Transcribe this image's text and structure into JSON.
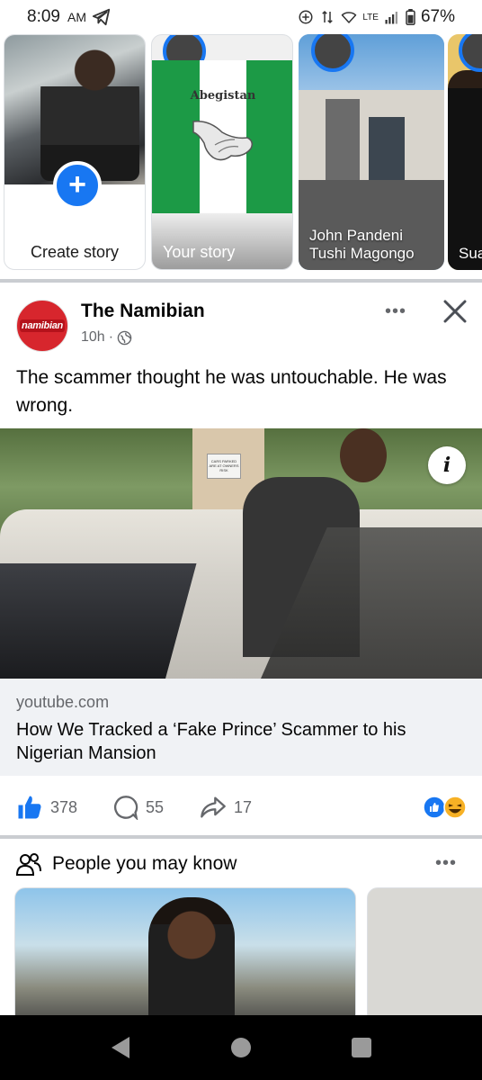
{
  "status_bar": {
    "time": "8:09",
    "ampm": "AM",
    "network": "LTE",
    "battery": "67%"
  },
  "stories": {
    "create_label": "Create story",
    "your_story_label": "Your story",
    "your_story_flag_text": "Abegistan",
    "items": [
      {
        "name": "John Pandeni Tushi Magongo"
      },
      {
        "name": "Sua"
      }
    ]
  },
  "post": {
    "page_name": "The Namibian",
    "page_logo_text": "namibian",
    "time_ago": "10h",
    "text": "The scammer thought he was untouchable. He was wrong.",
    "image_sign_text": "CARS PARKED ARE AT OWNERS RISK",
    "link_domain": "youtube.com",
    "link_title": "How We Tracked a ‘Fake Prince’ Scammer to his Nigerian Mansion",
    "likes": "378",
    "comments": "55",
    "shares": "17"
  },
  "pymk": {
    "title": "People you may know"
  },
  "colors": {
    "accent": "#1877f2",
    "secondary_text": "#65676b",
    "divider": "#cacdd1"
  },
  "icons": [
    "telegram-icon",
    "location-icon",
    "wifi-icon",
    "signal-icon",
    "battery-icon",
    "plus-icon",
    "globe-icon",
    "more-icon",
    "close-icon",
    "info-icon",
    "like-icon",
    "comment-icon",
    "share-icon",
    "reaction-like-icon",
    "reaction-haha-icon",
    "people-icon",
    "back-icon",
    "home-icon",
    "recents-icon"
  ]
}
